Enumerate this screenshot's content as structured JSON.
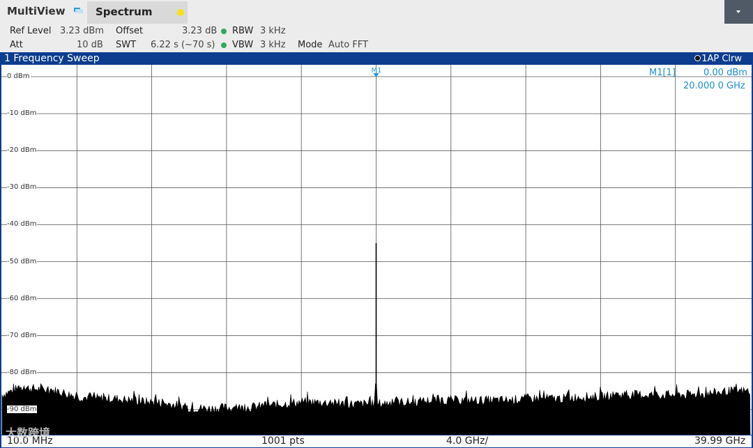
{
  "topbar": {
    "app_title": "MultiView",
    "tab_label": "Spectrum"
  },
  "params": {
    "ref_level_label": "Ref Level",
    "ref_level_value": "3.23 dBm",
    "offset_label": "Offset",
    "offset_value": "3.23 dB",
    "rbw_label": "RBW",
    "rbw_value": "3 kHz",
    "att_label": "Att",
    "att_value": "10 dB",
    "swt_label": "SWT",
    "swt_value": "6.22 s (~70 s)",
    "vbw_label": "VBW",
    "vbw_value": "3 kHz",
    "mode_label": "Mode",
    "mode_value": "Auto FFT"
  },
  "window": {
    "title": "1 Frequency Sweep",
    "trace_info": "1AP Clrw"
  },
  "marker": {
    "tag": "M1",
    "readout_name": "M1[1]",
    "readout_level": "0.00 dBm",
    "readout_freq": "20.000 0 GHz"
  },
  "footer": {
    "start": "10.0 MHz",
    "points": "1001 pts",
    "span": "4.0 GHz/",
    "stop": "39.99 GHz"
  },
  "watermark": "大数跨境",
  "chart_data": {
    "type": "line",
    "x_unit": "GHz",
    "y_unit": "dBm",
    "xlim": [
      0.01,
      39.99
    ],
    "ylim": [
      -90,
      0
    ],
    "y_ticks": [
      "0 dBm",
      "-10 dBm",
      "-20 dBm",
      "-30 dBm",
      "-40 dBm",
      "-50 dBm",
      "-60 dBm",
      "-70 dBm",
      "-80 dBm",
      "-90 dBm"
    ],
    "y_tick_values": [
      0,
      -10,
      -20,
      -30,
      -40,
      -50,
      -60,
      -70,
      -80,
      -90
    ],
    "grid": true,
    "series": [
      {
        "x": [
          0.01,
          1,
          2,
          3,
          4,
          5,
          6,
          7,
          8,
          9,
          10,
          11,
          12,
          13,
          14,
          15,
          16,
          17,
          18,
          19,
          19.95,
          20,
          20.05,
          21,
          22,
          23,
          24,
          25,
          26,
          27,
          28,
          29,
          30,
          31,
          32,
          33,
          34,
          35,
          36,
          37,
          38,
          39,
          39.99
        ],
        "y": [
          -86,
          -84,
          -84.5,
          -85,
          -86.5,
          -87,
          -87,
          -87.5,
          -88,
          -88.5,
          -89.5,
          -89.7,
          -89.5,
          -89.5,
          -89,
          -88.5,
          -88,
          -88,
          -88.5,
          -88.5,
          -88.5,
          -45,
          -88.5,
          -88,
          -88,
          -87.5,
          -87.5,
          -87.5,
          -87.5,
          -87.5,
          -87,
          -87,
          -87,
          -86.5,
          -86.5,
          -86,
          -86,
          -86,
          -86,
          -86,
          -85.5,
          -85,
          -85
        ]
      }
    ],
    "marker": {
      "name": "M1",
      "x": 20.0,
      "y": 0.0
    }
  }
}
